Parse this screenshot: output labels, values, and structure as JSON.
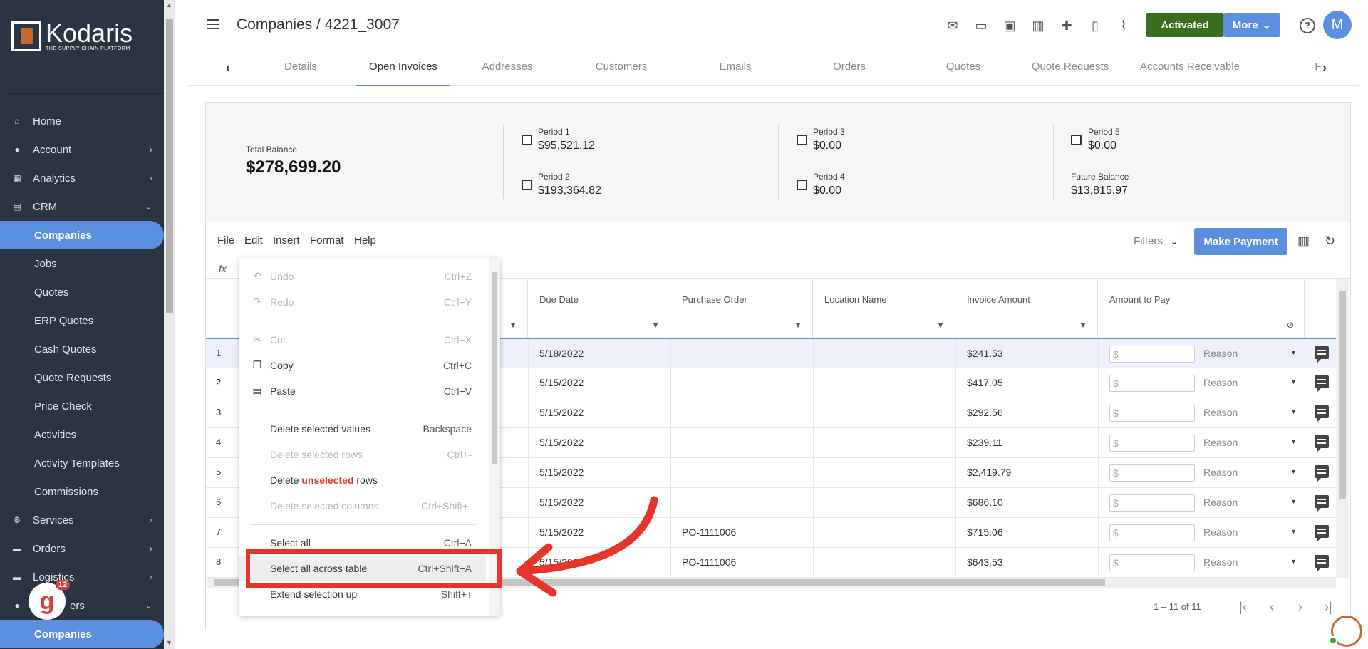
{
  "brand": {
    "name": "Kodaris",
    "tagline": "THE SUPPLY CHAIN PLATFORM"
  },
  "sidebar": {
    "badge_count": "12",
    "items": [
      {
        "label": "Home",
        "icon": "home-icon"
      },
      {
        "label": "Account",
        "icon": "user-icon"
      },
      {
        "label": "Analytics",
        "icon": "analytics-icon"
      },
      {
        "label": "CRM",
        "icon": "crm-icon"
      },
      {
        "label": "Companies"
      },
      {
        "label": "Jobs"
      },
      {
        "label": "Quotes"
      },
      {
        "label": "ERP Quotes"
      },
      {
        "label": "Cash Quotes"
      },
      {
        "label": "Quote Requests"
      },
      {
        "label": "Price Check"
      },
      {
        "label": "Activities"
      },
      {
        "label": "Activity Templates"
      },
      {
        "label": "Commissions"
      },
      {
        "label": "Services",
        "icon": "services-icon"
      },
      {
        "label": "Orders",
        "icon": "truck-icon"
      },
      {
        "label": "Logistics",
        "icon": "logistics-icon"
      },
      {
        "label": "ers",
        "icon": "users-icon"
      },
      {
        "label": "Companies"
      }
    ]
  },
  "header": {
    "title": "Companies / 4221_3007",
    "activated_label": "Activated",
    "more_label": "More",
    "avatar_initial": "M"
  },
  "tabs": [
    "Details",
    "Open Invoices",
    "Addresses",
    "Customers",
    "Emails",
    "Orders",
    "Quotes",
    "Quote Requests",
    "Accounts Receivable",
    "F"
  ],
  "summary": {
    "total_label": "Total Balance",
    "total_value": "$278,699.20",
    "period1_label": "Period 1",
    "period1_value": "$95,521.12",
    "period2_label": "Period 2",
    "period2_value": "$193,364.82",
    "period3_label": "Period 3",
    "period3_value": "$0.00",
    "period4_label": "Period 4",
    "period4_value": "$0.00",
    "period5_label": "Period 5",
    "period5_value": "$0.00",
    "future_label": "Future Balance",
    "future_value": "$13,815.97"
  },
  "toolbar": {
    "menu": [
      "File",
      "Edit",
      "Insert",
      "Format",
      "Help"
    ],
    "filters_label": "Filters",
    "make_payment_label": "Make Payment",
    "fx_label": "fx"
  },
  "table": {
    "columns": [
      "Due Date",
      "Purchase Order",
      "Location Name",
      "Invoice Amount",
      "Amount to Pay"
    ],
    "rows": [
      {
        "num": "1",
        "due": "5/18/2022",
        "po": "",
        "loc": "",
        "amount": "$241.53"
      },
      {
        "num": "2",
        "due": "5/15/2022",
        "po": "",
        "loc": "",
        "amount": "$417.05"
      },
      {
        "num": "3",
        "due": "5/15/2022",
        "po": "",
        "loc": "",
        "amount": "$292.56"
      },
      {
        "num": "4",
        "due": "5/15/2022",
        "po": "",
        "loc": "",
        "amount": "$239.11"
      },
      {
        "num": "5",
        "due": "5/15/2022",
        "po": "",
        "loc": "",
        "amount": "$2,419.79"
      },
      {
        "num": "6",
        "due": "5/15/2022",
        "po": "",
        "loc": "",
        "amount": "$686.10"
      },
      {
        "num": "7",
        "due": "5/15/2022",
        "po": "PO-1111006",
        "loc": "",
        "amount": "$715.06"
      },
      {
        "num": "8",
        "due": "5/15/2022",
        "po": "PO-1111006",
        "loc": "",
        "amount": "$643.53"
      }
    ],
    "input_placeholder": "$",
    "reason_label": "Reason"
  },
  "pager": {
    "range": "1 – 11 of 11"
  },
  "context_menu": {
    "items": [
      {
        "label": "Undo",
        "shortcut": "Ctrl+Z"
      },
      {
        "label": "Redo",
        "shortcut": "Ctrl+Y"
      },
      {
        "label": "Cut",
        "shortcut": "Ctrl+X"
      },
      {
        "label": "Copy",
        "shortcut": "Ctrl+C"
      },
      {
        "label": "Paste",
        "shortcut": "Ctrl+V"
      },
      {
        "label": "Delete selected values",
        "shortcut": "Backspace"
      },
      {
        "label": "Delete selected rows",
        "shortcut": "Ctrl+-"
      },
      {
        "label_pre": "Delete ",
        "label_red": "unselected",
        "label_post": " rows"
      },
      {
        "label": "Delete selected columns",
        "shortcut": "Ctrl+Shift+-"
      },
      {
        "label": "Select all",
        "shortcut": "Ctrl+A"
      },
      {
        "label": "Select all across table",
        "shortcut": "Ctrl+Shift+A"
      },
      {
        "label": "Extend selection up",
        "shortcut": "Shift+↑"
      }
    ]
  },
  "colors": {
    "accent": "#5b8fe0",
    "sidebar_bg": "#2b3443",
    "activated": "#3a6e1f",
    "annotation": "#e8352b"
  }
}
